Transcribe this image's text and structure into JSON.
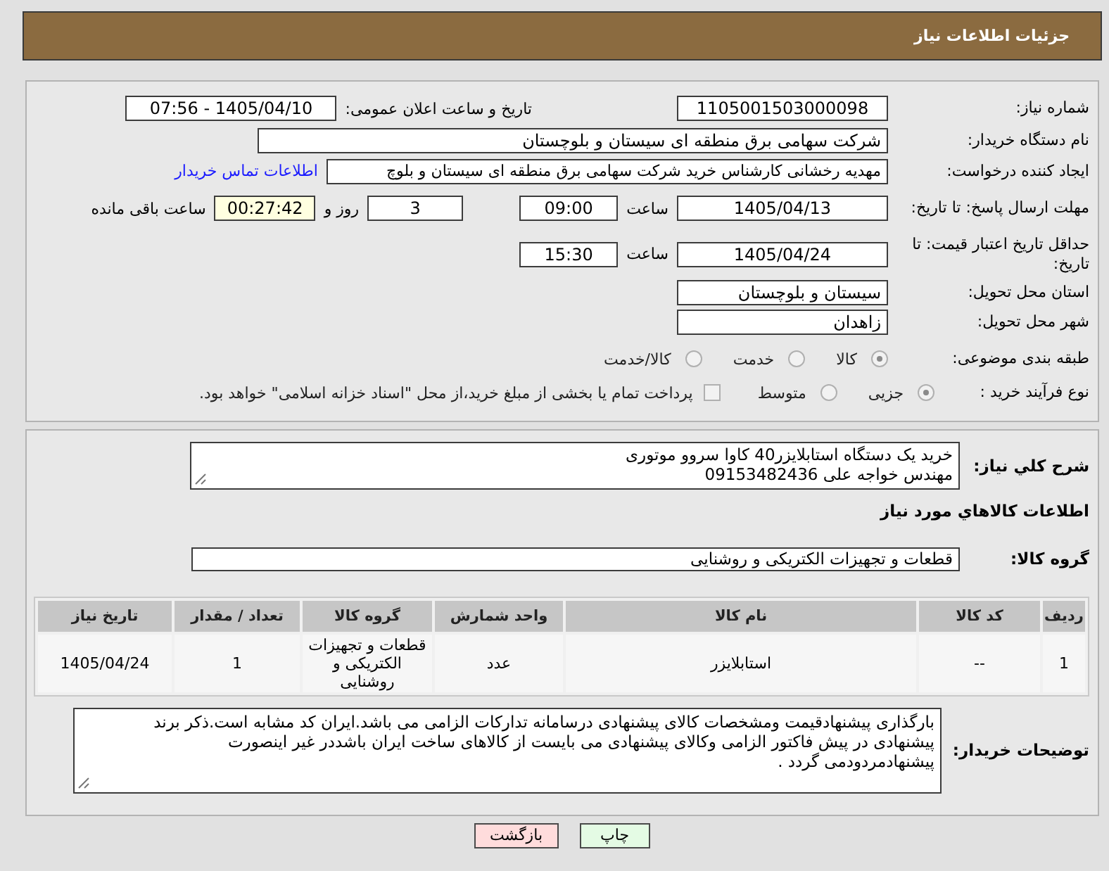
{
  "header": {
    "title": "جزئیات اطلاعات نیاز"
  },
  "details": {
    "need_number": {
      "label": "شماره نیاز:",
      "value": "1105001503000098"
    },
    "announce_datetime": {
      "label": "تاریخ و ساعت اعلان عمومی:",
      "value": "1405/04/10 - 07:56"
    },
    "buyer_org": {
      "label": "نام دستگاه خریدار:",
      "value": "شرکت سهامی برق منطقه ای سیستان و بلوچستان"
    },
    "requester": {
      "label": "ایجاد کننده درخواست:",
      "value": "مهدیه رخشانی کارشناس خرید شرکت سهامی برق منطقه ای سیستان و بلوچ",
      "link": "اطلاعات تماس خریدار"
    },
    "reply_deadline": {
      "label": "مهلت ارسال پاسخ: تا تاریخ:",
      "date": "1405/04/13",
      "time_label": "ساعت",
      "time": "09:00",
      "days": "3",
      "days_label": "روز و",
      "remaining": "00:27:42",
      "remaining_label": "ساعت باقی مانده"
    },
    "price_validity": {
      "label": "حداقل تاریخ اعتبار قیمت: تا تاریخ:",
      "date": "1405/04/24",
      "time_label": "ساعت",
      "time": "15:30"
    },
    "province": {
      "label": "استان محل تحویل:",
      "value": "سیستان و بلوچستان"
    },
    "city": {
      "label": "شهر محل تحویل:",
      "value": "زاهدان"
    },
    "category": {
      "label": "طبقه بندی موضوعی:",
      "options": [
        {
          "label": "کالا",
          "selected": true
        },
        {
          "label": "خدمت",
          "selected": false
        },
        {
          "label": "کالا/خدمت",
          "selected": false
        }
      ]
    },
    "process": {
      "label": "نوع فرآیند خرید :",
      "options": [
        {
          "label": "جزیی",
          "selected": true
        },
        {
          "label": "متوسط",
          "selected": false
        }
      ],
      "treasury_payment": {
        "label": "پرداخت تمام یا بخشی از مبلغ خرید،از محل \"اسناد خزانه اسلامی\" خواهد بود.",
        "checked": false
      }
    }
  },
  "goods": {
    "description": {
      "label": "شرح کلي نياز:",
      "lines": [
        "خرید یک دستگاه استابلایزر40 کاوا سروو موتوری",
        "مهندس خواجه علی 09153482436"
      ]
    },
    "section_title": "اطلاعات کالاهاي مورد نياز",
    "group": {
      "label": "گروه کالا:",
      "value": "قطعات و تجهیزات الکتریکی و روشنایی"
    },
    "table": {
      "columns": [
        "ردیف",
        "کد کالا",
        "نام کالا",
        "واحد شمارش",
        "گروه کالا",
        "تعداد / مقدار",
        "تاریخ نیاز"
      ],
      "rows": [
        [
          "1",
          "--",
          "استابلایزر",
          "عدد",
          "قطعات و تجهیزات الکتریکی و روشنایی",
          "1",
          "1405/04/24"
        ]
      ]
    },
    "buyer_notes": {
      "label": "توضیحات خریدار:",
      "lines": [
        "بارگذاری پیشنهادقیمت ومشخصات کالای پیشنهادی درسامانه تدارکات الزامی می باشد.ایران کد مشابه است.ذکر برند",
        "پیشنهادی در پیش فاکتور الزامی وکالای پیشنهادی می بایست از کالاهای ساخت ایران باشددر غیر اینصورت",
        "پیشنهادمردودمی گردد ."
      ]
    }
  },
  "buttons": [
    {
      "label": "چاپ",
      "kind": "print"
    },
    {
      "label": "بازگشت",
      "kind": "back"
    }
  ]
}
